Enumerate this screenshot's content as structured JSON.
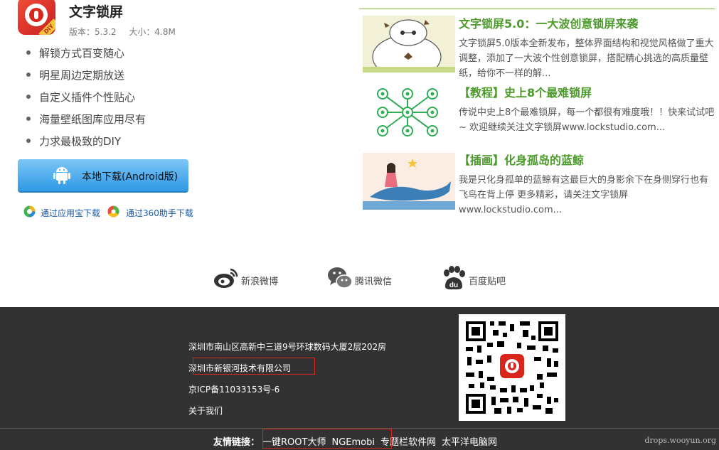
{
  "app": {
    "title": "文字锁屏",
    "version": "版本：5.3.2",
    "size": "大小：4.8M",
    "icon_badge": "DIY"
  },
  "features": [
    "解锁方式百变随心",
    "明星周边定期放送",
    "自定义插件个性贴心",
    "海量壁纸图库应用尽有",
    "力求最极致的DIY"
  ],
  "download": {
    "label": "本地下载(Android版)",
    "alt_yyb": "通过应用宝下载",
    "alt_360": "通过360助手下载"
  },
  "news": [
    {
      "title": "文字锁屏5.0：一大波创意锁屏来袭",
      "desc": "文字锁屏5.0版本全新发布，整体界面结构和视觉风格做了重大调整，添加了一大波个性创意锁屏，搭配精心挑选的高质量壁纸，给你不一样的解..."
    },
    {
      "title": "【教程】史上8个最难锁屏",
      "desc": "传说中史上8个最难锁屏，每一个都很有难度哦！！快来试试吧~ 欢迎继续关注文字锁屏www.lockstudio.com..."
    },
    {
      "title": "【插画】化身孤岛的蓝鲸",
      "desc": "我是只化身孤单的蓝鲸有这最巨大的身影余下在身侧穿行也有飞鸟在背上停 更多精彩，请关注文字锁屏www.lockstudio.com..."
    }
  ],
  "social": {
    "weibo": "新浪微博",
    "wechat": "腾讯微信",
    "tieba": "百度贴吧"
  },
  "footer": {
    "address": "深圳市南山区高新中三道9号环球数码大厦2层202房",
    "company": "深圳市新银河技术有限公司",
    "icp": "京ICP备11033153号-6",
    "about": "关于我们",
    "friends_label": "友情链接：",
    "friends": [
      "一键ROOT大师",
      "NGEmobi",
      "专题栏软件网",
      "太平洋电脑网"
    ]
  },
  "watermark": "drops.wooyun.org",
  "colors": {
    "accent_green": "#4c9a2a",
    "brand_red": "#d9261c",
    "download_blue": "#2f99e6",
    "footer_bg": "#323232"
  }
}
